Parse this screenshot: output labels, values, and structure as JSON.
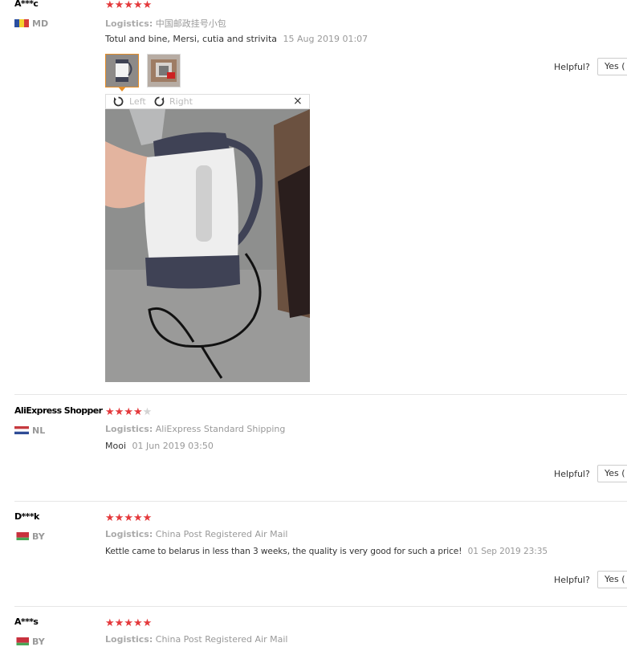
{
  "colors": {
    "star": "#e4393c",
    "star_empty": "#d3d3d3",
    "thumb_active": "#e58e29"
  },
  "helpful_label": "Helpful?",
  "yes_label": "Yes (",
  "logistics_label": "Logistics:",
  "viewer": {
    "left_label": "Left",
    "right_label": "Right",
    "close": "×"
  },
  "reviews": [
    {
      "user": "A***c",
      "country": "MD",
      "rating": 5,
      "logistics": "中国邮政挂号小包",
      "text": "Totul and bine, Mersi, cutia and strivita",
      "date": "15 Aug 2019 01:07"
    },
    {
      "user": "AliExpress Shopper",
      "country": "NL",
      "rating": 4,
      "logistics": "AliExpress Standard Shipping",
      "text": "Mooi",
      "date": "01 Jun 2019 03:50"
    },
    {
      "user": "D***k",
      "country": "BY",
      "rating": 5,
      "logistics": "China Post Registered Air Mail",
      "text": "Kettle came to belarus in less than 3 weeks, the quality is very good for such a price!",
      "date": "01 Sep 2019 23:35"
    },
    {
      "user": "A***s",
      "country": "BY",
      "rating": 5,
      "logistics": "China Post Registered Air Mail"
    }
  ]
}
